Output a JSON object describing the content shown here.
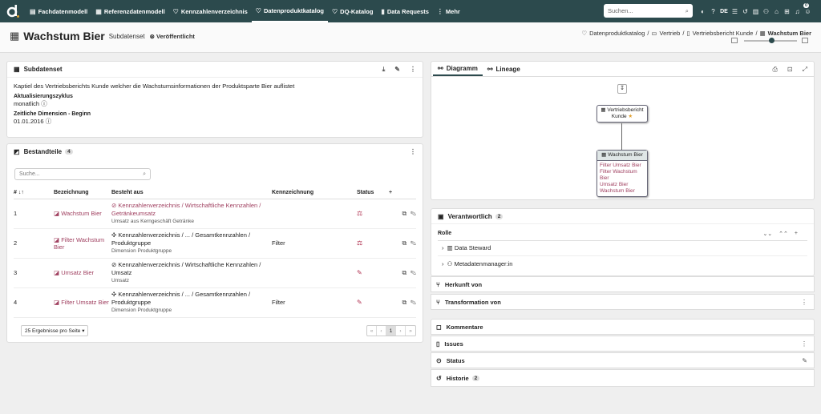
{
  "nav": {
    "items": [
      {
        "label": "Fachdatenmodell",
        "icon": "▤"
      },
      {
        "label": "Referenzdatenmodell",
        "icon": "▦"
      },
      {
        "label": "Kennzahlenverzeichnis",
        "icon": "♡"
      },
      {
        "label": "Datenproduktkatalog",
        "icon": "♡"
      },
      {
        "label": "DQ-Katalog",
        "icon": "♡"
      },
      {
        "label": "Data Requests",
        "icon": "▮"
      },
      {
        "label": "Mehr",
        "icon": "⋮"
      }
    ],
    "search_placeholder": "Suchen...",
    "lang": "DE",
    "notif_count": "0"
  },
  "header": {
    "title": "Wachstum Bier",
    "subtitle": "Subdatenset",
    "status": "Veröffentlicht",
    "breadcrumb": [
      "Datenproduktkatalog",
      "Vertrieb",
      "Vertriebsbericht Kunde",
      "Wachstum Bier"
    ]
  },
  "subdatenset": {
    "title": "Subdatenset",
    "description": "Kaptiel des Vertriebsberichts Kunde welcher die Wachstumsinformationen der Produktsparte Bier auflistet",
    "cycle_label": "Aktualisierungszyklus",
    "cycle_value": "monatlich",
    "dim_label": "Zeitliche Dimension - Beginn",
    "dim_value": "01.01.2016"
  },
  "bestandteile": {
    "title": "Bestandteile",
    "count": "4",
    "search_placeholder": "Suche...",
    "columns": [
      "#",
      "Bezeichnung",
      "Besteht aus",
      "Kennzeichnung",
      "Status"
    ],
    "rows": [
      {
        "num": "1",
        "name": "Wachstum Bier",
        "path": "Kennzahlenverzeichnis / Wirtschaftliche Kennzahlen / Getränkeumsatz",
        "sub": "Umsatz aus Kerngeschäft Getränke",
        "kenn": "",
        "status": "⚖"
      },
      {
        "num": "2",
        "name": "Filter Wachstum Bier",
        "path": "Kennzahlenverzeichnis / ... / Gesamtkennzahlen / Produktgruppe",
        "sub": "Dimension Produktgruppe",
        "kenn": "Filter",
        "status": "⚖"
      },
      {
        "num": "3",
        "name": "Umsatz Bier",
        "path": "Kennzahlenverzeichnis / Wirtschaftliche Kennzahlen / Umsatz",
        "sub": "Umsatz",
        "kenn": "",
        "status": "✎"
      },
      {
        "num": "4",
        "name": "Filter Umsatz Bier",
        "path": "Kennzahlenverzeichnis / ... / Gesamtkennzahlen / Produktgruppe",
        "sub": "Dimension Produktgruppe",
        "kenn": "Filter",
        "status": "✎"
      }
    ],
    "per_page": "25 Ergebnisse pro Seite",
    "page": "1"
  },
  "diagram": {
    "tabs": [
      "Diagramm",
      "Lineage"
    ],
    "parent_node": "Vertriebsbericht Kunde",
    "child_node": "Wachstum Bier",
    "child_items": [
      "Filter Umsatz Bier",
      "Filter Wachstum Bier",
      "Umsatz Bier",
      "Wachstum Bier"
    ]
  },
  "verantwortlich": {
    "title": "Verantwortlich",
    "count": "2",
    "col": "Rolle",
    "roles": [
      "Data Steward",
      "Metadatenmanager:in"
    ]
  },
  "sections": {
    "herkunft": "Herkunft von",
    "transformation": "Transformation von",
    "kommentare": "Kommentare",
    "issues": "Issues",
    "status": "Status",
    "historie": "Historie",
    "historie_count": "2"
  }
}
